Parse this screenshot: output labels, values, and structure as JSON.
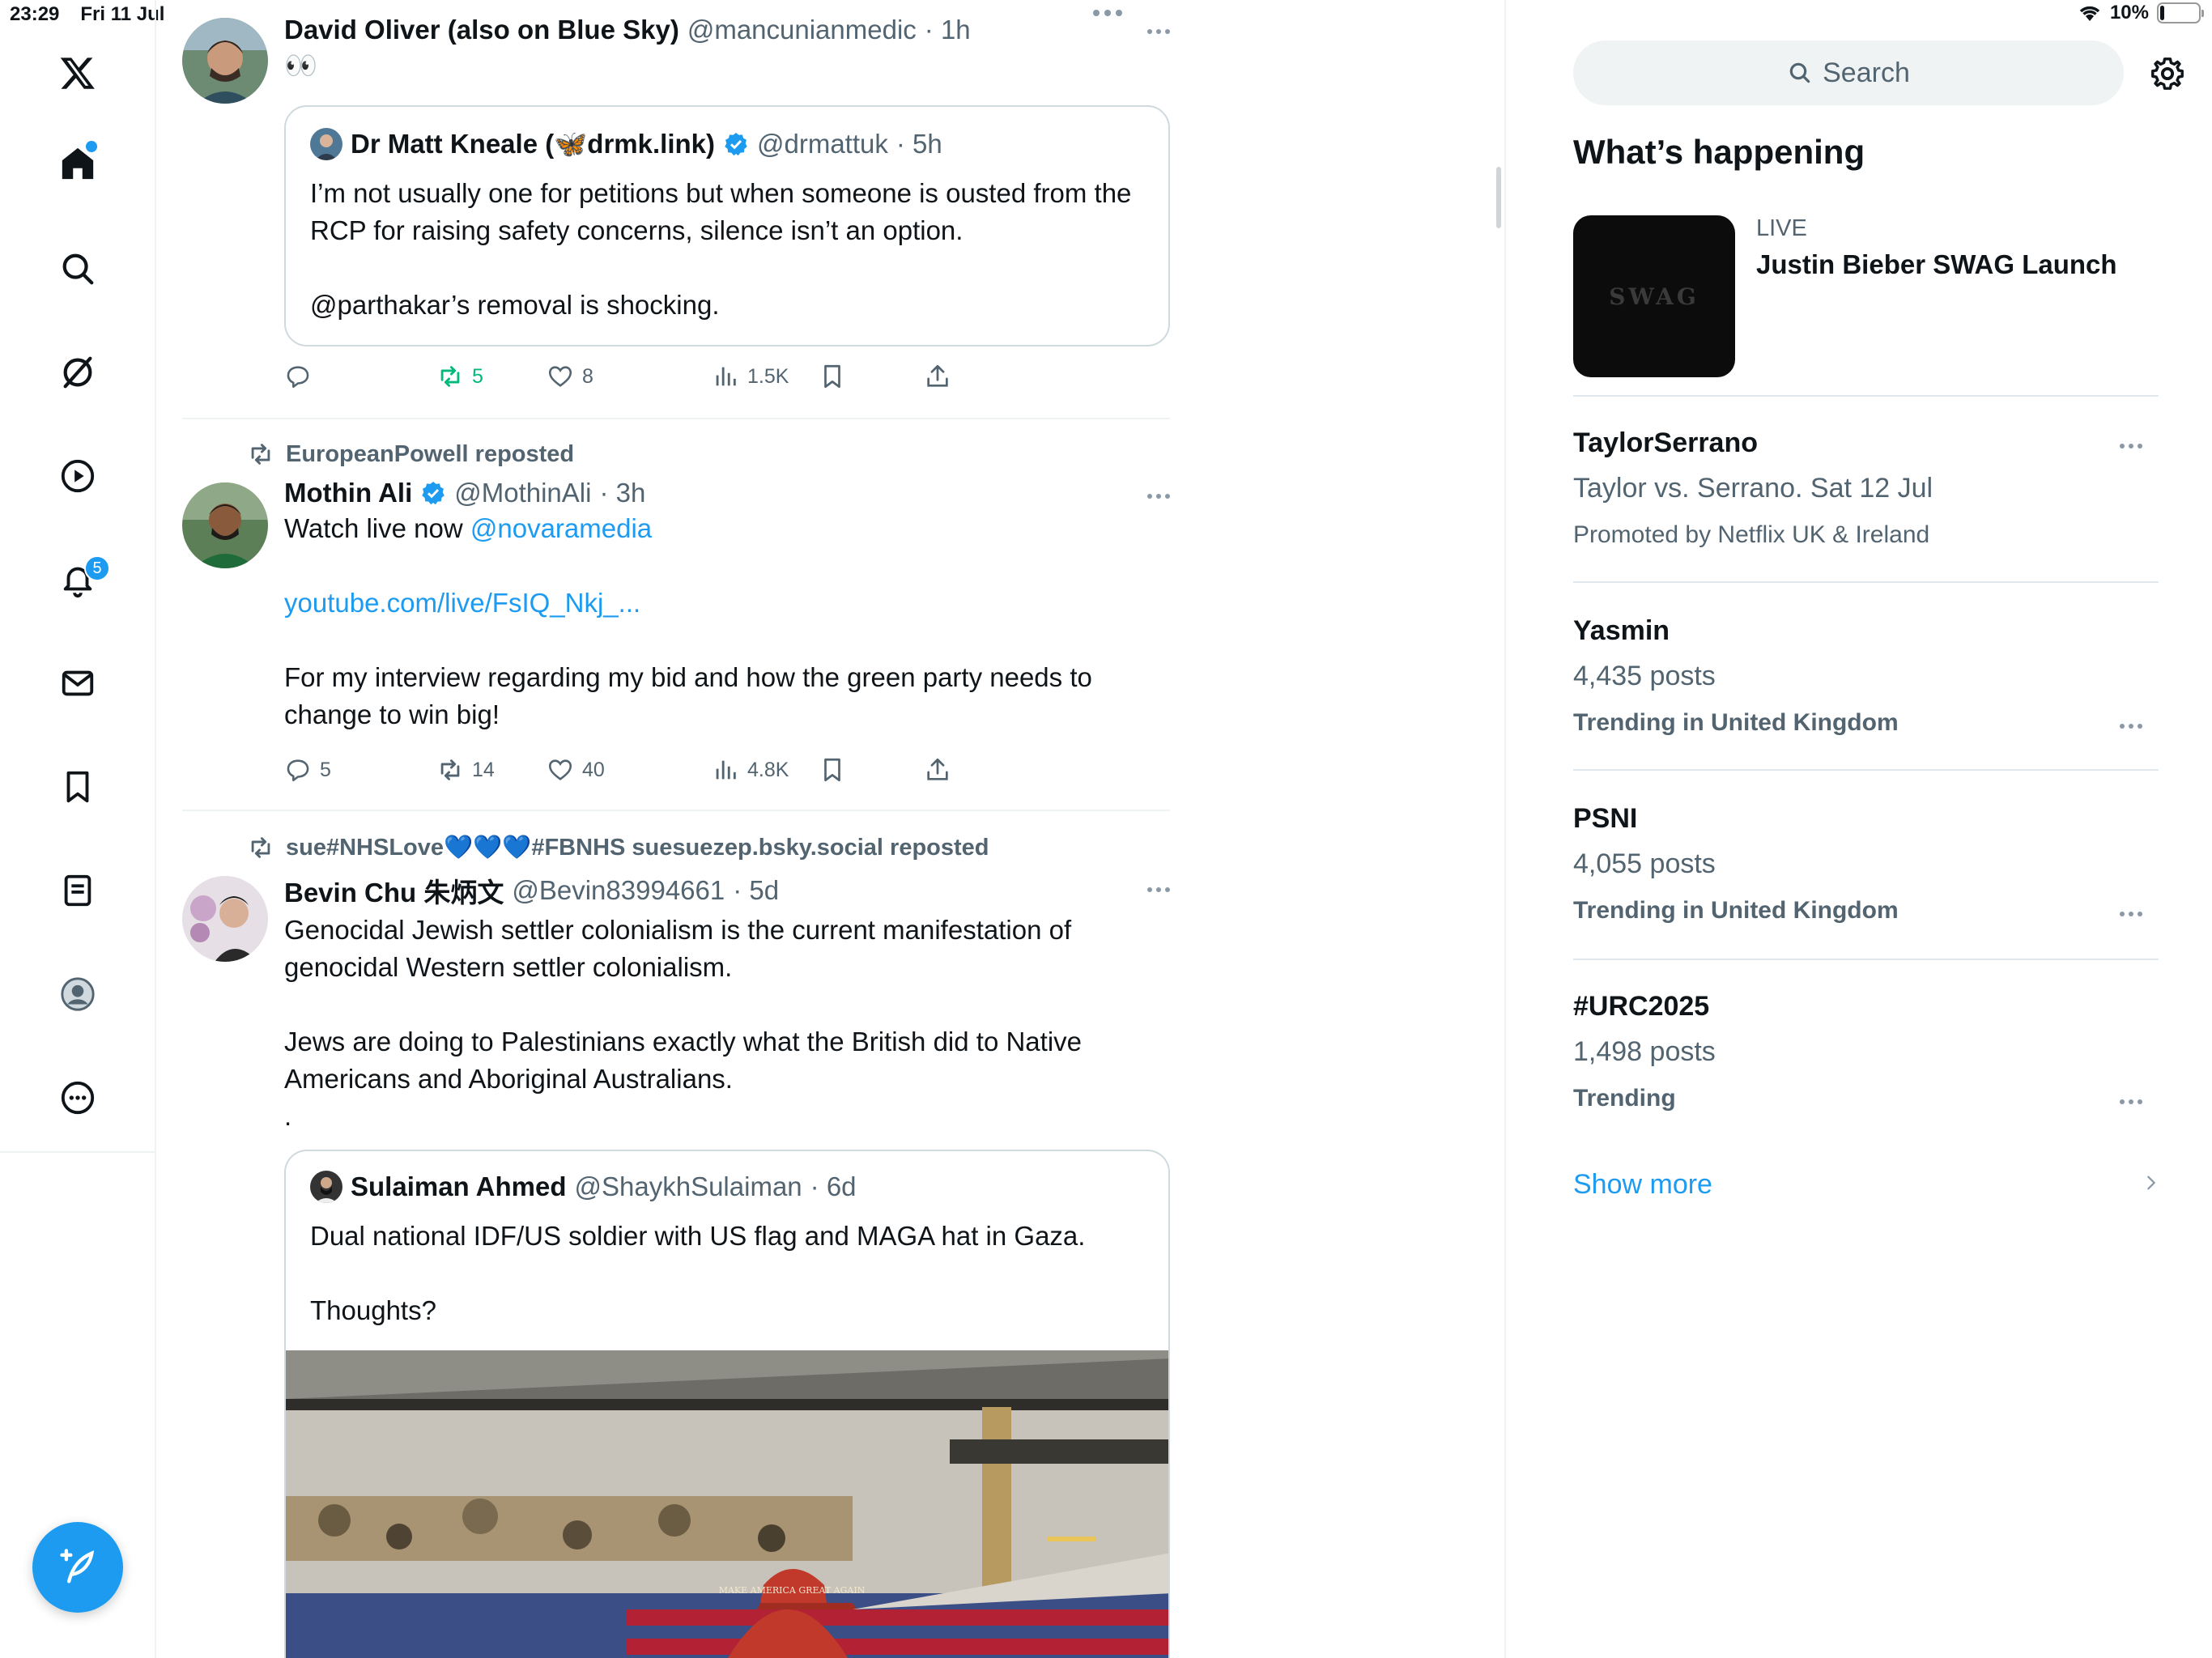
{
  "status": {
    "time": "23:29",
    "date": "Fri 11 Jul",
    "battery": "10%",
    "battery_level": 0.1
  },
  "nav": {
    "items": [
      "x-logo",
      "home",
      "explore",
      "grok",
      "video",
      "notifications",
      "messages",
      "bookmarks",
      "lists",
      "profile",
      "more"
    ],
    "notifications_badge": "5"
  },
  "tweets": [
    {
      "name": "David Oliver (also on Blue Sky)",
      "handle": "@mancunianmedic",
      "time": "· 1h",
      "text": "👀",
      "quote": {
        "name": "Dr Matt Kneale (🦋drmk.link)",
        "handle": "@drmattuk",
        "time": "· 5h",
        "text": "I’m not usually one for petitions but when someone is ousted from the RCP for raising safety concerns, silence isn’t an option.\n\n@parthakar’s removal is shocking."
      },
      "actions": {
        "replies": "",
        "reposts": "5",
        "likes": "8",
        "views": "1.5K"
      }
    },
    {
      "repost_by": "EuropeanPowell reposted",
      "name": "Mothin Ali",
      "handle": "@MothinAli",
      "time": "· 3h",
      "text_prefix": "Watch live now ",
      "mention": "@novaramedia",
      "link": "youtube.com/live/FsIQ_Nkj_...",
      "text_suffix": "For my interview regarding my bid and how the green party needs to change to win big!",
      "actions": {
        "replies": "5",
        "reposts": "14",
        "likes": "40",
        "views": "4.8K"
      }
    },
    {
      "repost_by": "sue#NHSLove💙💙💙#FBNHS suesuezep.bsky.social reposted",
      "name": "Bevin Chu 朱炳文",
      "handle": "@Bevin83994661",
      "time": "· 5d",
      "text": "Genocidal Jewish settler colonialism is the current manifestation of genocidal Western settler colonialism.\n\nJews are doing to Palestinians exactly what the British did to Native Americans and Aboriginal Australians.\n.",
      "quote": {
        "name": "Sulaiman Ahmed",
        "handle": "@ShaykhSulaiman",
        "time": "· 6d",
        "text": "Dual national IDF/US soldier with US flag and MAGA hat in Gaza.\n\nThoughts?",
        "hat_text": "MAKE AMERICA GREAT AGAIN"
      }
    }
  ],
  "right": {
    "search_placeholder": "Search",
    "section_title": "What’s happening",
    "live": {
      "label": "LIVE",
      "title": "Justin Bieber SWAG Launch",
      "thumb_text": "SWAG"
    },
    "trends": [
      {
        "title": "TaylorSerrano",
        "subtitle": "Taylor vs. Serrano. Sat 12 Jul",
        "meta": "Promoted by Netflix UK & Ireland"
      },
      {
        "title": "Yasmin",
        "subtitle": "4,435 posts",
        "meta": "Trending in United Kingdom"
      },
      {
        "title": "PSNI",
        "subtitle": "4,055 posts",
        "meta": "Trending in United Kingdom"
      },
      {
        "title": "#URC2025",
        "subtitle": "1,498 posts",
        "meta": "Trending"
      }
    ],
    "show_more": "Show more"
  },
  "colors": {
    "accent": "#1d9bf0",
    "repost_green": "#00ba7c",
    "muted": "#536471",
    "border": "#eff3f4"
  }
}
